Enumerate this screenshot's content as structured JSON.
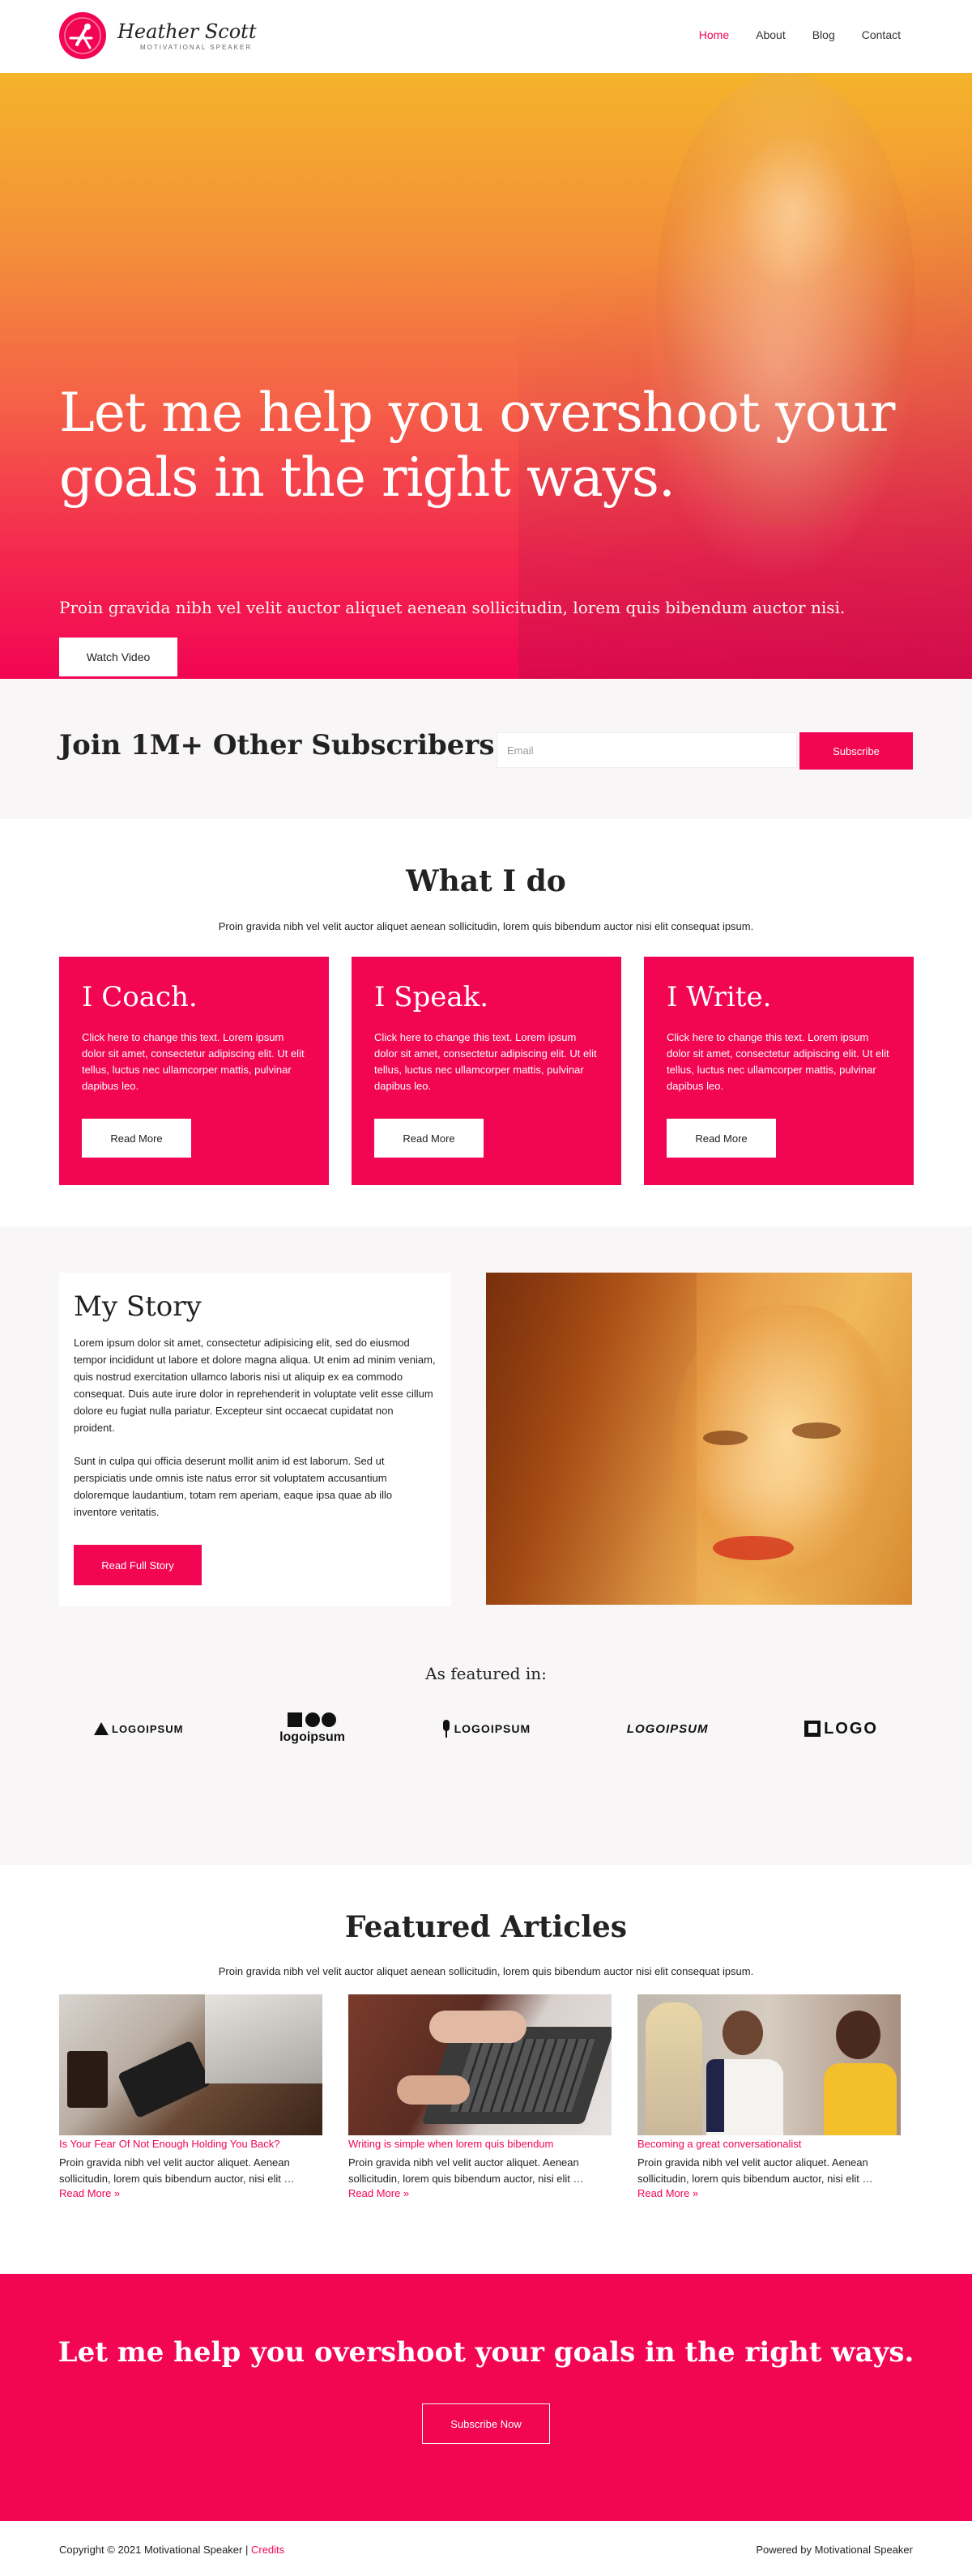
{
  "brand": {
    "name": "Heather Scott",
    "tagline": "MOTIVATIONAL SPEAKER"
  },
  "nav": {
    "items": [
      {
        "label": "Home",
        "active": true
      },
      {
        "label": "About"
      },
      {
        "label": "Blog"
      },
      {
        "label": "Contact"
      }
    ]
  },
  "hero": {
    "title": "Let me help you overshoot your goals in the right ways.",
    "subtitle": "Proin gravida nibh vel velit auctor aliquet aenean sollicitudin, lorem quis bibendum auctor nisi.",
    "button": "Watch Video"
  },
  "subscribe": {
    "title": "Join 1M+ Other Subscribers",
    "placeholder": "Email",
    "button": "Subscribe"
  },
  "what_i_do": {
    "title": "What I do",
    "description": "Proin gravida nibh vel velit auctor aliquet aenean sollicitudin, lorem quis bibendum auctor nisi elit consequat ipsum.",
    "cards": [
      {
        "title": "I Coach.",
        "text": "Click here to change this text. Lorem ipsum dolor sit amet, consectetur adipiscing elit. Ut elit tellus, luctus nec ullamcorper mattis, pulvinar dapibus leo.",
        "button": "Read More"
      },
      {
        "title": "I Speak.",
        "text": "Click here to change this text. Lorem ipsum dolor sit amet, consectetur adipiscing elit. Ut elit tellus, luctus nec ullamcorper mattis, pulvinar dapibus leo.",
        "button": "Read More"
      },
      {
        "title": "I Write.",
        "text": "Click here to change this text. Lorem ipsum dolor sit amet, consectetur adipiscing elit. Ut elit tellus, luctus nec ullamcorper mattis, pulvinar dapibus leo.",
        "button": "Read More"
      }
    ]
  },
  "story": {
    "title": "My Story",
    "paragraphs": [
      "Lorem ipsum dolor sit amet, consectetur adipisicing elit, sed do eiusmod tempor incididunt ut labore et dolore magna aliqua. Ut enim ad minim veniam, quis nostrud exercitation ullamco laboris nisi ut aliquip ex ea commodo consequat. Duis aute irure dolor in reprehenderit in voluptate velit esse cillum dolore eu fugiat nulla pariatur. Excepteur sint occaecat cupidatat non proident.",
      "Sunt in culpa qui officia deserunt mollit anim id est laborum. Sed ut perspiciatis unde omnis iste natus error sit voluptatem accusantium doloremque laudantium, totam rem aperiam, eaque ipsa quae ab illo inventore veritatis."
    ],
    "button": "Read Full Story"
  },
  "featured_in": {
    "title": "As featured in:",
    "logos": [
      "LOGOIPSUM",
      "logoipsum",
      "LOGOIPSUM",
      "LOGOIPSUM",
      "LOGO"
    ]
  },
  "articles": {
    "title": "Featured Articles",
    "description": "Proin gravida nibh vel velit auctor aliquet aenean sollicitudin, lorem quis bibendum auctor nisi elit consequat ipsum.",
    "items": [
      {
        "title": "Is Your Fear Of Not Enough Holding You Back?",
        "excerpt": "Proin gravida nibh vel velit auctor aliquet. Aenean sollicitudin, lorem quis bibendum auctor, nisi elit …",
        "more": "Read More »"
      },
      {
        "title": "Writing is simple when lorem quis bibendum",
        "excerpt": "Proin gravida nibh vel velit auctor aliquet. Aenean sollicitudin, lorem quis bibendum auctor, nisi elit …",
        "more": "Read More »"
      },
      {
        "title": "Becoming a great conversationalist",
        "excerpt": "Proin gravida nibh vel velit auctor aliquet. Aenean sollicitudin, lorem quis bibendum auctor, nisi elit …",
        "more": "Read More »"
      }
    ]
  },
  "cta": {
    "title": "Let me help you overshoot your goals in the right ways.",
    "button": "Subscribe Now"
  },
  "footer": {
    "copyright": "Copyright © 2021 Motivational Speaker | ",
    "credits": "Credits",
    "powered": "Powered by Motivational Speaker"
  },
  "colors": {
    "accent": "#f20553",
    "section_bg": "#f8f6f6"
  }
}
